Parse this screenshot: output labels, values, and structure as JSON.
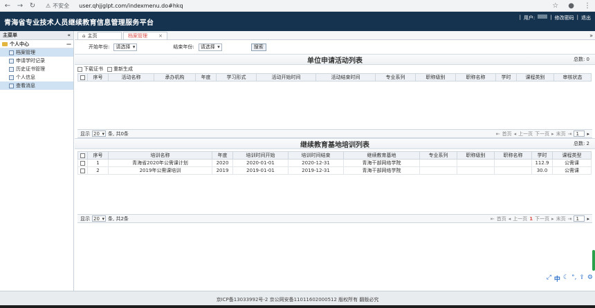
{
  "browser": {
    "security_label": "不安全",
    "url": "user.qhjjglpt.com/indexmenu.do#hkq"
  },
  "header": {
    "title": "青海省专业技术人员继续教育信息管理服务平台",
    "user_label": "用户:",
    "change_password": "修改密码",
    "logout": "退出",
    "sep": "|"
  },
  "sidebar": {
    "title": "主菜单",
    "collapse": "«",
    "group": "个人中心",
    "group_toggle": "—",
    "items": [
      {
        "label": "档案管理"
      },
      {
        "label": "申请学时记录"
      },
      {
        "label": "历史证书管理"
      },
      {
        "label": "个人信息"
      },
      {
        "label": "查看消息"
      }
    ]
  },
  "tabs": [
    {
      "label": "主页"
    },
    {
      "label": "档案管理",
      "close": "×"
    }
  ],
  "tabs_more": "»",
  "filter": {
    "start_label": "开始年份:",
    "start_value": "请选择",
    "end_label": "结束年份:",
    "end_value": "请选择",
    "search_button": "搜索"
  },
  "section1": {
    "title": "单位申请活动列表",
    "total": "总数: 0",
    "toolbar": {
      "download": "下载证书",
      "regenerate": "重新生成"
    },
    "columns": [
      "",
      "序号",
      "活动名称",
      "承办机构",
      "年度",
      "学习形式",
      "活动开始时间",
      "活动结束时间",
      "专业系列",
      "职称级别",
      "职称名称",
      "学时",
      "课程类别",
      "审核状态"
    ],
    "pager": {
      "show": "显示",
      "size": "20",
      "summary": "条, 共0条",
      "first": "首页",
      "prev": "上一页",
      "next": "下一页",
      "last": "末页",
      "page": "1"
    }
  },
  "section2": {
    "title": "继续教育基地培训列表",
    "total": "总数: 2",
    "columns": [
      "",
      "序号",
      "培训名称",
      "年度",
      "培训时间开始",
      "培训时间结束",
      "继续教育基地",
      "专业系列",
      "职称级别",
      "职称名称",
      "学时",
      "课程类型"
    ],
    "rows": [
      [
        "1",
        "青海省2020年公需课计划",
        "2020",
        "2020-01-01",
        "2020-12-31",
        "青海干部网络学院",
        "",
        "",
        "",
        "112.9",
        "公需课"
      ],
      [
        "2",
        "2019年公需课培训",
        "2019",
        "2019-01-01",
        "2019-12-31",
        "青海干部网络学院",
        "",
        "",
        "",
        "30.0",
        "公需课"
      ]
    ],
    "pager": {
      "show": "显示",
      "size": "20",
      "summary": "条, 共2条",
      "first": "首页",
      "prev": "上一页",
      "current": "1",
      "next": "下一页",
      "last": "末页",
      "page": "1"
    }
  },
  "floating_toolbar": {
    "lang": "中"
  },
  "footer": {
    "text": "京ICP备13033992号-2 京公网安备11011602000512 版权所有 翻版必究"
  }
}
